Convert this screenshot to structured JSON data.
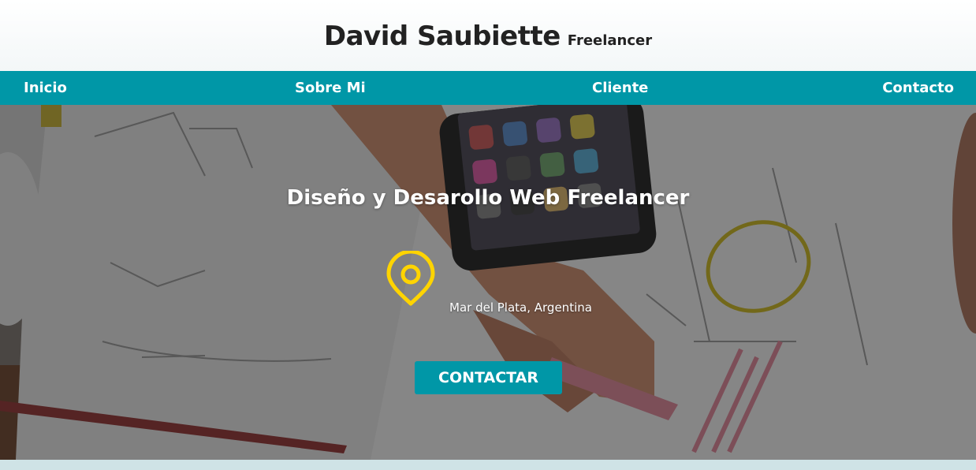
{
  "header": {
    "brand_name": "David Saubiette",
    "brand_tagline": "Freelancer"
  },
  "nav": {
    "items": [
      {
        "label": "Inicio"
      },
      {
        "label": "Sobre Mi"
      },
      {
        "label": "Cliente"
      },
      {
        "label": "Contacto"
      }
    ]
  },
  "hero": {
    "title": "Diseño y Desarollo Web Freelancer",
    "location": "Mar del Plata, Argentina",
    "location_icon": "map-pin-icon",
    "cta_label": "CONTACTAR"
  },
  "colors": {
    "accent": "#0097a7",
    "pin": "#ffd400",
    "text_dark": "#222222",
    "text_light": "#ffffff"
  }
}
